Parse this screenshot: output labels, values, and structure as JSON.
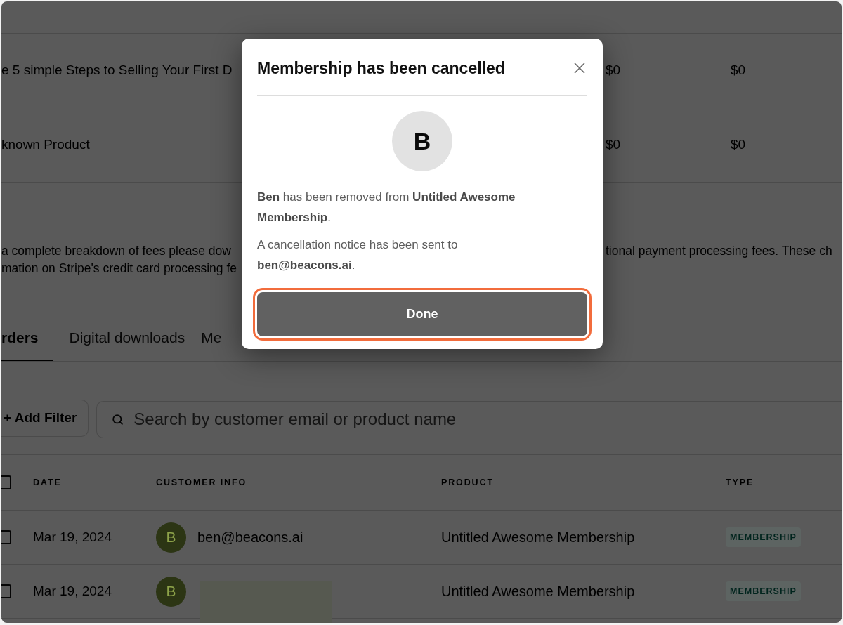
{
  "background_page": {
    "product_rows": [
      {
        "column_1": "e 5 simple Steps to Selling Your First D",
        "column_2": "$0",
        "column_3": "$0"
      },
      {
        "column_1": "known Product",
        "column_2": "$0",
        "column_3": "$0"
      }
    ],
    "fees_note": {
      "line_1_left": "a complete breakdown of fees please dow",
      "line_1_right": "tional payment processing fees. These ch",
      "line_2_left": "mation on Stripe's credit card processing fe"
    },
    "tabs": [
      {
        "label": "rders",
        "selected": true
      },
      {
        "label": "Digital downloads",
        "selected": false
      },
      {
        "label": "Me",
        "selected": false
      }
    ],
    "add_filter_button": "+ Add Filter",
    "search": {
      "placeholder": "Search by customer email or product name"
    },
    "orders_table": {
      "select_all": {
        "checked": false
      },
      "columns": [
        "DATE",
        "CUSTOMER INFO",
        "PRODUCT",
        "TYPE"
      ],
      "rows": [
        {
          "checked": false,
          "date": "Mar 19, 2024",
          "avatar": "B",
          "email": "ben@beacons.ai",
          "redacted": false,
          "product": "Untitled Awesome Membership",
          "type": "MEMBERSHIP"
        },
        {
          "checked": false,
          "date": "Mar 19, 2024",
          "avatar": "B",
          "redacted": true,
          "product": "Untitled Awesome Membership",
          "type": "MEMBERSHIP"
        }
      ]
    }
  },
  "modal": {
    "title": "Membership has been cancelled",
    "avatar": "B",
    "messages": [
      "**Ben** has been removed from **Untitled Awesome Membership**.",
      "A cancellation notice has been sent to **ben@beacons.ai**."
    ],
    "button": {
      "label": "Done",
      "highlighted": true
    }
  }
}
